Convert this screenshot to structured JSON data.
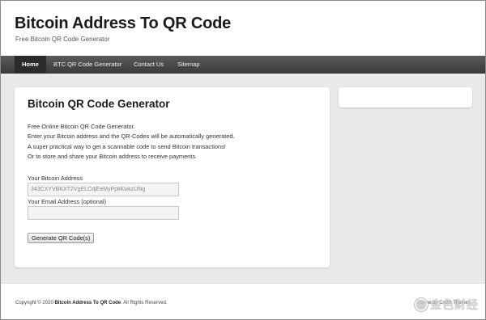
{
  "header": {
    "title": "Bitcoin Address To QR Code",
    "description": "Free Bitcoin QR Code Generator"
  },
  "nav": {
    "items": [
      {
        "label": "Home",
        "active": true
      },
      {
        "label": "BTC QR Code Generator"
      },
      {
        "label": "Contact Us"
      },
      {
        "label": "Sitemap"
      }
    ]
  },
  "main": {
    "heading": "Bitcoin QR Code Generator",
    "intro": [
      "Free Online Bitcoin QR Code Generator.",
      "Enter your Bitcoin address and the QR-Codes will be automatically generated.",
      "A super practical way to get a scannable code to send Bitcoin transactions!",
      "Or to store and share your Bitcoin address to receive payments."
    ],
    "address_label": "Your Bitcoin Address",
    "address_value": "343CXYVBKXT2VgELCdjEeMyPpfiKwkzUNg",
    "email_label": "Your Email Address (optional)",
    "email_value": "",
    "generate_button": "Generate QR Code(s)"
  },
  "footer": {
    "copyright_prefix": "Copyright © 2020 ",
    "site_name": "Bitcoin Address To QR Code",
    "rights": ". All Rights Reserved.",
    "theme_credit": "Theme by Catch Themes"
  },
  "watermark": {
    "text": "金色财经"
  },
  "colors": {
    "nav_bg": "#4a4a4a",
    "nav_active": "#2b2b2b",
    "page_bg": "#e9e9e9",
    "card_bg": "#ffffff"
  }
}
